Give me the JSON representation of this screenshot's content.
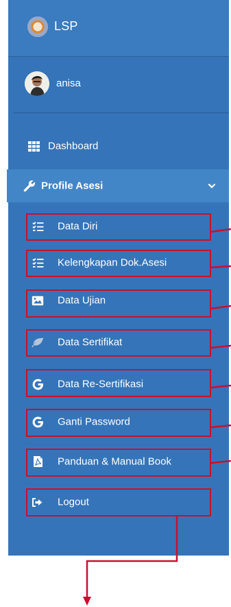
{
  "brand": {
    "title": "LSP"
  },
  "user": {
    "name": "anisa"
  },
  "nav": {
    "dashboard": "Dashboard",
    "profile": "Profile Asesi",
    "items": [
      {
        "label": "Data Diri",
        "icon": "list-check-icon"
      },
      {
        "label": "Kelengkapan Dok.Asesi",
        "icon": "list-check-icon"
      },
      {
        "label": "Data Ujian",
        "icon": "image-icon"
      },
      {
        "label": "Data Sertifikat",
        "icon": "leaf-icon"
      },
      {
        "label": "Data Re-Sertifikasi",
        "icon": "google-g-icon"
      },
      {
        "label": "Ganti Password",
        "icon": "google-g-icon"
      },
      {
        "label": "Panduan & Manual Book",
        "icon": "pdf-file-icon"
      },
      {
        "label": "Logout",
        "icon": "sign-out-icon"
      }
    ]
  },
  "colors": {
    "sidebar": "#3574b9",
    "active": "#4386c8",
    "highlight": "#c8102e"
  }
}
